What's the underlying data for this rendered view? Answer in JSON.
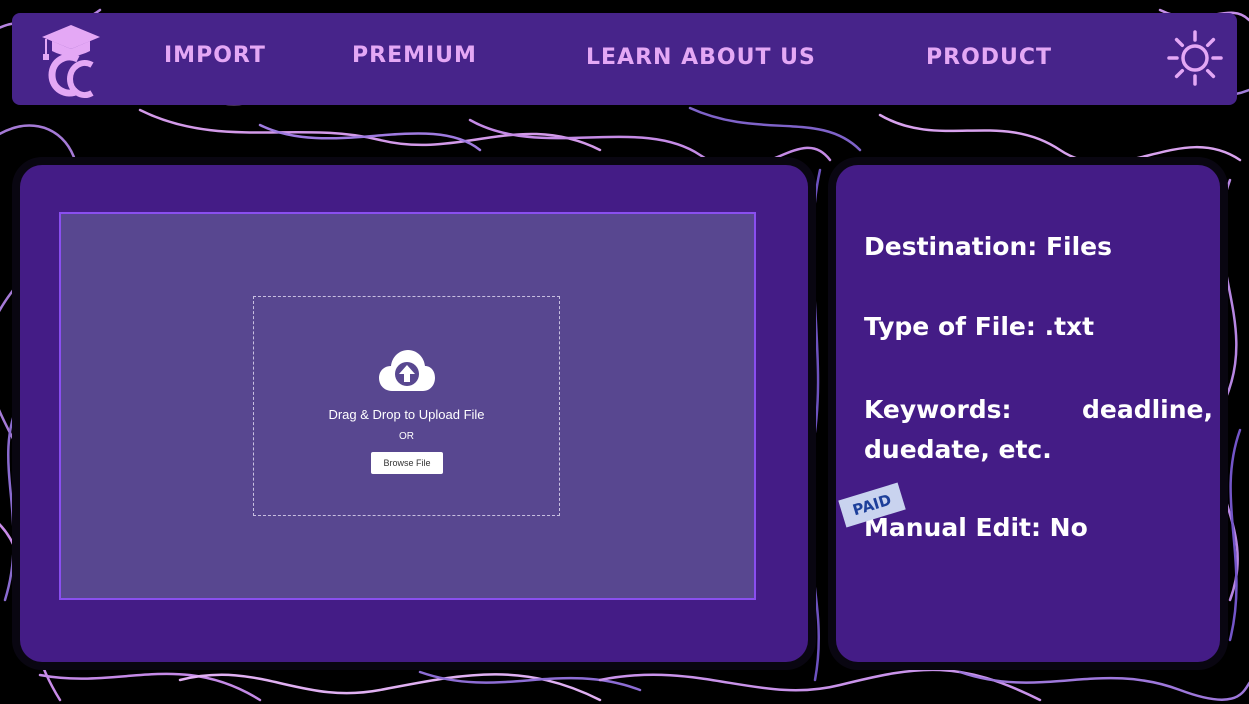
{
  "nav": {
    "logo_label": "CC",
    "links": [
      "IMPORT",
      "PREMIUM",
      "LEARN ABOUT US",
      "PRODUCT"
    ],
    "theme_icon": "sun-icon"
  },
  "upload": {
    "icon": "cloud-upload-icon",
    "drop_text": "Drag & Drop to Upload File",
    "or_text": "OR",
    "browse_label": "Browse File"
  },
  "info": {
    "destination": "Destination: Files",
    "file_type": "Type of File: .txt",
    "keywords_label": "Keywords:",
    "keywords_value": "deadline,",
    "keywords_value_line2": "duedate, etc.",
    "manual_edit": "Manual Edit: No",
    "badge": "PAID"
  },
  "colors": {
    "background": "#000000",
    "nav_bg": "#47248a",
    "panel_bg": "#441c86",
    "upload_bg": "#584790",
    "upload_border": "#8a4ff0",
    "accent": "#e4a8f5",
    "badge_bg": "#c9d3ef",
    "badge_text": "#1d3f9a"
  }
}
